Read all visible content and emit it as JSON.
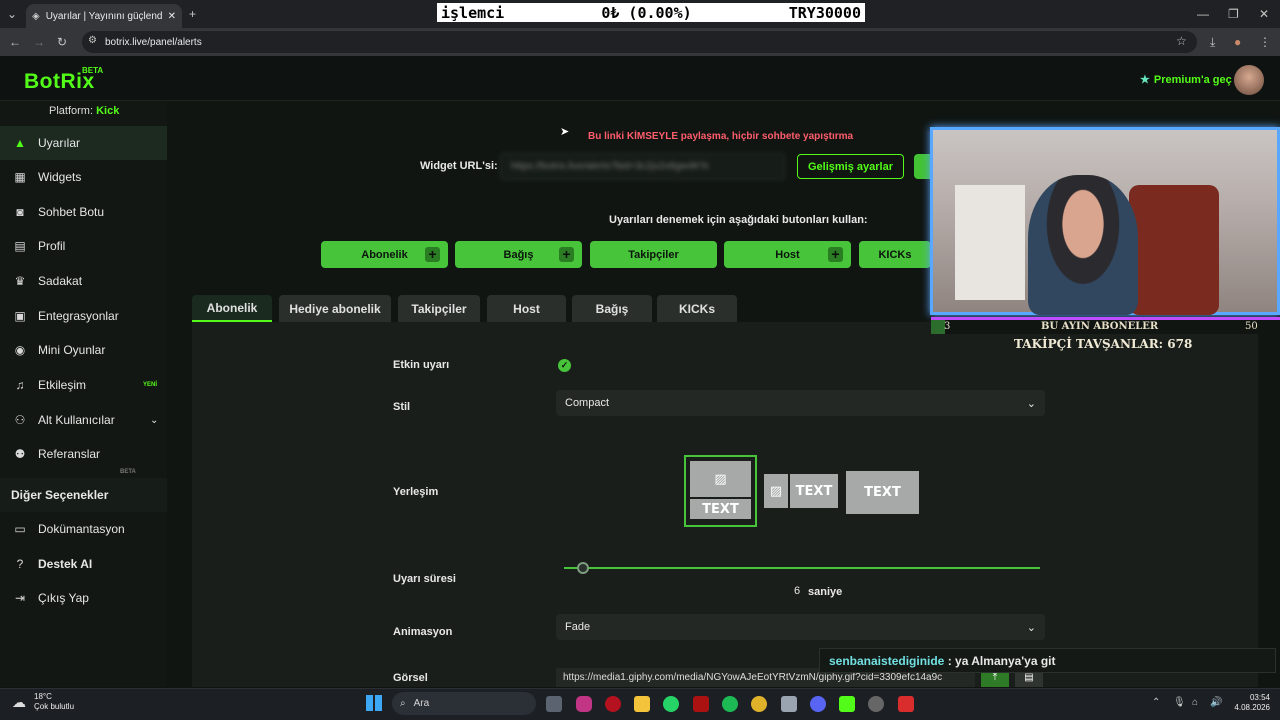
{
  "browser": {
    "tab_title": "Uyarılar | Yayınını güçlendirme",
    "url": "botrix.live/panel/alerts"
  },
  "ticker": {
    "left": "işlemci",
    "mid": "0₺ (0.00%)",
    "right": "TRY30000"
  },
  "app": {
    "logo": "BotRix",
    "logo_badge": "BETA",
    "premium": "Premium'a geç"
  },
  "sidebar": {
    "platform_label": "Platform:",
    "platform_value": "Kick",
    "items": [
      {
        "label": "Uyarılar",
        "icon": "warning-icon"
      },
      {
        "label": "Widgets",
        "icon": "grid-icon"
      },
      {
        "label": "Sohbet Botu",
        "icon": "robot-icon"
      },
      {
        "label": "Profil",
        "icon": "id-card-icon"
      },
      {
        "label": "Sadakat",
        "icon": "trophy-icon"
      },
      {
        "label": "Entegrasyonlar",
        "icon": "plugin-icon"
      },
      {
        "label": "Mini Oyunlar",
        "icon": "gamepad-icon"
      },
      {
        "label": "Etkileşim",
        "icon": "music-icon",
        "badge": "YENİ"
      },
      {
        "label": "Alt Kullanıcılar",
        "icon": "users-icon",
        "badge": "BETA"
      },
      {
        "label": "Referanslar",
        "icon": "people-icon"
      }
    ],
    "section": "Diğer Seçenekler",
    "more": [
      {
        "label": "Dokümantasyon",
        "icon": "doc-icon"
      },
      {
        "label": "Destek AI",
        "icon": "help-icon"
      },
      {
        "label": "Çıkış Yap",
        "icon": "logout-icon"
      }
    ]
  },
  "main": {
    "warning": "Bu linki KİMSEYLE paylaşma, hiçbir sohbete yapıştırma",
    "widget_url_label": "Widget URL'si:",
    "widget_url_value": "https://botrix.live/alerts?bid=3c2jx2v8gw4K%",
    "advanced_button": "Gelişmiş ayarlar",
    "test_hint": "Uyarıları denemek için aşağıdaki butonları kullan:",
    "test_buttons": [
      "Abonelik",
      "Bağış",
      "Takipçiler",
      "Host",
      "KICKs"
    ],
    "tabs": [
      "Abonelik",
      "Hediye abonelik",
      "Takipçiler",
      "Host",
      "Bağış",
      "KICKs"
    ],
    "form": {
      "enabled_label": "Etkin uyarı",
      "style_label": "Stil",
      "style_value": "Compact",
      "layout_label": "Yerleşim",
      "layout_text": "TEXT",
      "duration_label": "Uyarı süresi",
      "duration_value": "6",
      "duration_unit": "saniye",
      "animation_label": "Animasyon",
      "animation_value": "Fade",
      "image_label": "Görsel",
      "image_value": "https://media1.giphy.com/media/NGYowAJeEotYRtVzmN/giphy.gif?cid=3309efc14a9c"
    }
  },
  "stream_overlay": {
    "strip_left": "3",
    "strip_center": "BU AYIN ABONELER",
    "strip_right": "50",
    "followers": "TAKİPÇİ TAVŞANLAR: 678",
    "chat_user": "senbanaistediginide",
    "chat_sep": " : ",
    "chat_text": "ya Almanya'ya git"
  },
  "taskbar": {
    "temp": "18°C",
    "weather": "Çok bulutlu",
    "search": "Ara",
    "time": "03:54",
    "date": "4.08.2026"
  },
  "colors": {
    "accent": "#53fc18",
    "button_green": "#48c43b",
    "warning": "#ff5d6c"
  }
}
